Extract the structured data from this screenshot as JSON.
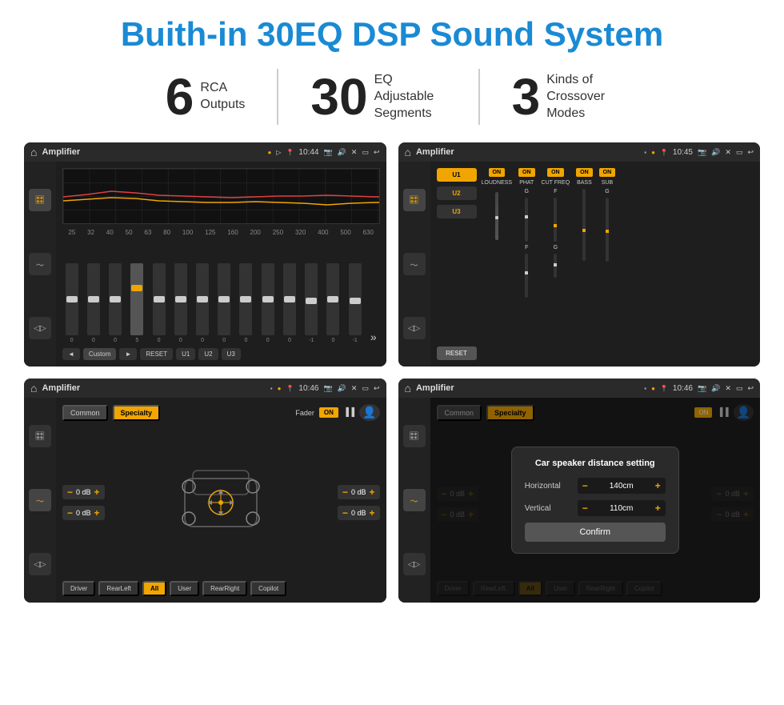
{
  "page": {
    "title": "Buith-in 30EQ DSP Sound System",
    "background": "#ffffff"
  },
  "stats": [
    {
      "number": "6",
      "text_line1": "RCA",
      "text_line2": "Outputs"
    },
    {
      "number": "30",
      "text_line1": "EQ Adjustable",
      "text_line2": "Segments"
    },
    {
      "number": "3",
      "text_line1": "Kinds of",
      "text_line2": "Crossover Modes"
    }
  ],
  "screens": [
    {
      "id": "eq-screen",
      "status": {
        "app": "Amplifier",
        "time": "10:44"
      },
      "eq_labels": [
        "25",
        "32",
        "40",
        "50",
        "63",
        "80",
        "100",
        "125",
        "160",
        "200",
        "250",
        "320",
        "400",
        "500",
        "630"
      ],
      "eq_values": [
        "0",
        "0",
        "0",
        "5",
        "0",
        "0",
        "0",
        "0",
        "0",
        "0",
        "0",
        "-1",
        "0",
        "-1"
      ],
      "bottom_buttons": [
        "◄",
        "Custom",
        "►",
        "RESET",
        "U1",
        "U2",
        "U3"
      ]
    },
    {
      "id": "crossover-screen",
      "status": {
        "app": "Amplifier",
        "time": "10:45"
      },
      "presets": [
        "U1",
        "U2",
        "U3"
      ],
      "channels": [
        {
          "name": "LOUDNESS",
          "on": true
        },
        {
          "name": "PHAT",
          "on": true
        },
        {
          "name": "CUT FREQ",
          "on": true
        },
        {
          "name": "BASS",
          "on": true
        },
        {
          "name": "SUB",
          "on": true
        }
      ],
      "reset_btn": "RESET"
    },
    {
      "id": "fader-screen",
      "status": {
        "app": "Amplifier",
        "time": "10:46"
      },
      "tabs": [
        "Common",
        "Specialty"
      ],
      "active_tab": "Specialty",
      "fader_label": "Fader",
      "fader_toggle": "ON",
      "volumes": [
        "0 dB",
        "0 dB",
        "0 dB",
        "0 dB"
      ],
      "bottom_buttons": [
        "Driver",
        "RearLeft",
        "All",
        "User",
        "RearRight",
        "Copilot"
      ]
    },
    {
      "id": "distance-screen",
      "status": {
        "app": "Amplifier",
        "time": "10:46"
      },
      "tabs": [
        "Common",
        "Specialty"
      ],
      "active_tab": "Specialty",
      "dialog": {
        "title": "Car speaker distance setting",
        "horizontal_label": "Horizontal",
        "horizontal_value": "140cm",
        "vertical_label": "Vertical",
        "vertical_value": "110cm",
        "confirm_btn": "Confirm"
      },
      "volumes": [
        "0 dB",
        "0 dB"
      ],
      "bottom_buttons": [
        "Driver",
        "RearLeft.",
        "All",
        "User",
        "RearRight",
        "Copilot"
      ]
    }
  ]
}
